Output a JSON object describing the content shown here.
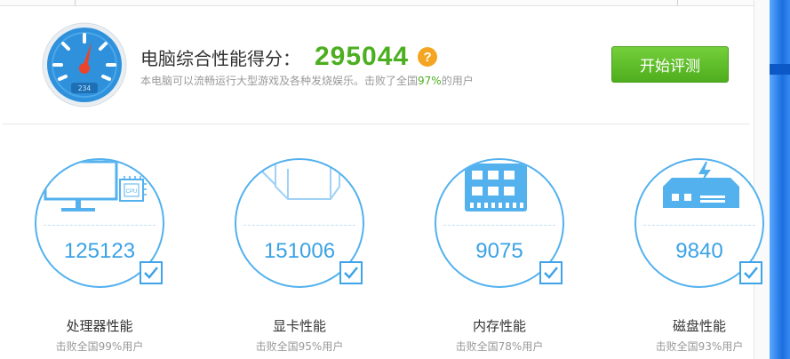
{
  "header": {
    "title": "电脑综合性能得分：",
    "score": "295044",
    "help_symbol": "?",
    "gauge_reading": "234",
    "subtitle_prefix": "本电脑可以流畅运行大型游戏及各种发烧娱乐。击败了全国",
    "subtitle_percent": "97%",
    "subtitle_suffix": "的用户",
    "start_button": "开始评测"
  },
  "cards": [
    {
      "icon": "cpu-monitor-icon",
      "value": "125123",
      "label": "处理器性能",
      "beat": "击败全国99%用户"
    },
    {
      "icon": "graphics-cube-icon",
      "value": "151006",
      "label": "显卡性能",
      "beat": "击败全国95%用户"
    },
    {
      "icon": "memory-chip-icon",
      "value": "9075",
      "label": "内存性能",
      "beat": "击败全国78%用户"
    },
    {
      "icon": "hard-disk-icon",
      "value": "9840",
      "label": "磁盘性能",
      "beat": "击败全国93%用户"
    }
  ],
  "cpu_chip_text": "CPU",
  "colors": {
    "accent_blue": "#3aa2e6",
    "score_green": "#4caf1f",
    "button_green": "#5fbf2a",
    "help_orange": "#f4a623"
  }
}
